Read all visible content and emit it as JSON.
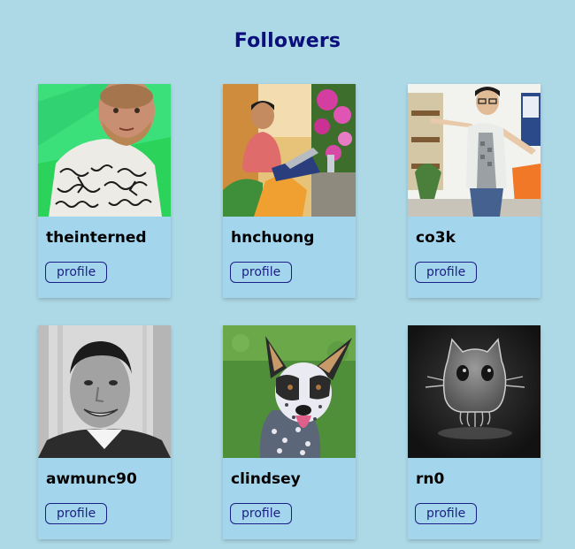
{
  "page": {
    "title": "Followers",
    "background": "#add8e6",
    "title_color": "#0b0f7a",
    "card_color": "#a3d5ec"
  },
  "followers": [
    {
      "username": "theinterned",
      "button_label": "profile",
      "avatar_icon": "avatar-man-patterned-shirt"
    },
    {
      "username": "hnchuong",
      "button_label": "profile",
      "avatar_icon": "avatar-man-with-laptop"
    },
    {
      "username": "co3k",
      "button_label": "profile",
      "avatar_icon": "avatar-man-arms-out"
    },
    {
      "username": "awmunc90",
      "button_label": "profile",
      "avatar_icon": "avatar-man-smiling-bw"
    },
    {
      "username": "clindsey",
      "button_label": "profile",
      "avatar_icon": "avatar-dog"
    },
    {
      "username": "rn0",
      "button_label": "profile",
      "avatar_icon": "avatar-ghost-octocat"
    }
  ]
}
